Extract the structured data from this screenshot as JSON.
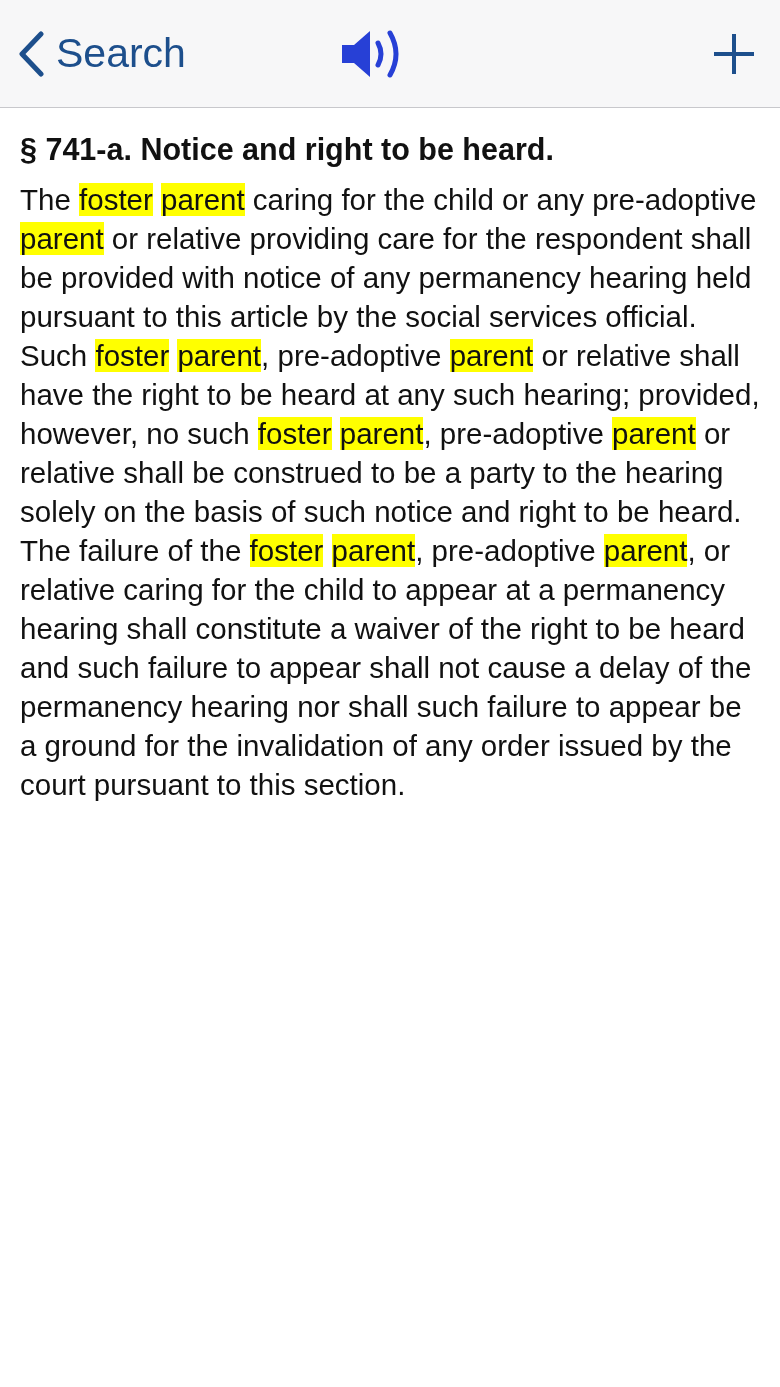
{
  "nav_bar": {
    "back_label": "Search"
  },
  "section": {
    "title": "§ 741-a. Notice and right to be heard.",
    "segments": [
      {
        "text": "The "
      },
      {
        "highlights": [
          "foster",
          "parent"
        ]
      },
      {
        "text": " caring for the child or any pre-adoptive "
      },
      {
        "highlights": [
          "parent"
        ]
      },
      {
        "text": " or relative providing care for the respondent shall be provided with notice of any permanency hearing held pursuant to this article by the social services official. Such "
      },
      {
        "highlights": [
          "foster",
          "parent"
        ]
      },
      {
        "text": ", pre-adoptive "
      },
      {
        "highlights": [
          "parent"
        ]
      },
      {
        "text": " or relative shall have the right to be heard at any such hearing; provided, however, no such "
      },
      {
        "highlights": [
          "foster",
          "parent"
        ]
      },
      {
        "text": ", pre-adoptive "
      },
      {
        "highlights": [
          "parent"
        ]
      },
      {
        "text": " or relative shall be construed to be a party to the hearing solely on the basis of such notice and right to be heard. The failure of the "
      },
      {
        "highlights": [
          "foster",
          "parent"
        ]
      },
      {
        "text": ", pre-adoptive "
      },
      {
        "highlights": [
          "parent"
        ]
      },
      {
        "text": ", or relative caring for the child to appear at a permanency hearing shall constitute a waiver of the right to be heard and such failure to appear shall not cause a delay of the permanency hearing nor shall such failure to appear be a ground for the invalidation of any order issued by the court pursuant to this section."
      }
    ]
  }
}
